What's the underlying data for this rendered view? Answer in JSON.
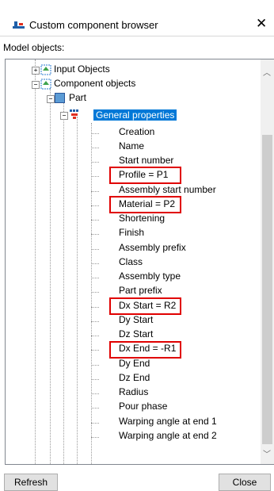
{
  "window": {
    "title": "Custom component browser"
  },
  "model_objects_label": "Model objects:",
  "tree": {
    "input_objects": "Input Objects",
    "component_objects": "Component objects",
    "part": "Part",
    "general_properties": "General properties",
    "properties": [
      "Creation",
      "Name",
      "Start number",
      "Profile = P1",
      "Assembly start number",
      "Material = P2",
      "Shortening",
      "Finish",
      "Assembly prefix",
      "Class",
      "Assembly type",
      "Part prefix",
      "Dx Start = R2",
      "Dy Start",
      "Dz Start",
      "Dx End = -R1",
      "Dy End",
      "Dz End",
      "Radius",
      "Pour phase",
      "Warping angle at end 1",
      "Warping angle at end 2"
    ],
    "highlighted": [
      "Profile = P1",
      "Material = P2",
      "Dx Start = R2",
      "Dx End = -R1"
    ]
  },
  "buttons": {
    "refresh": "Refresh",
    "close": "Close"
  },
  "colors": {
    "selection": "#0078d7",
    "highlight_box": "#e00000"
  }
}
